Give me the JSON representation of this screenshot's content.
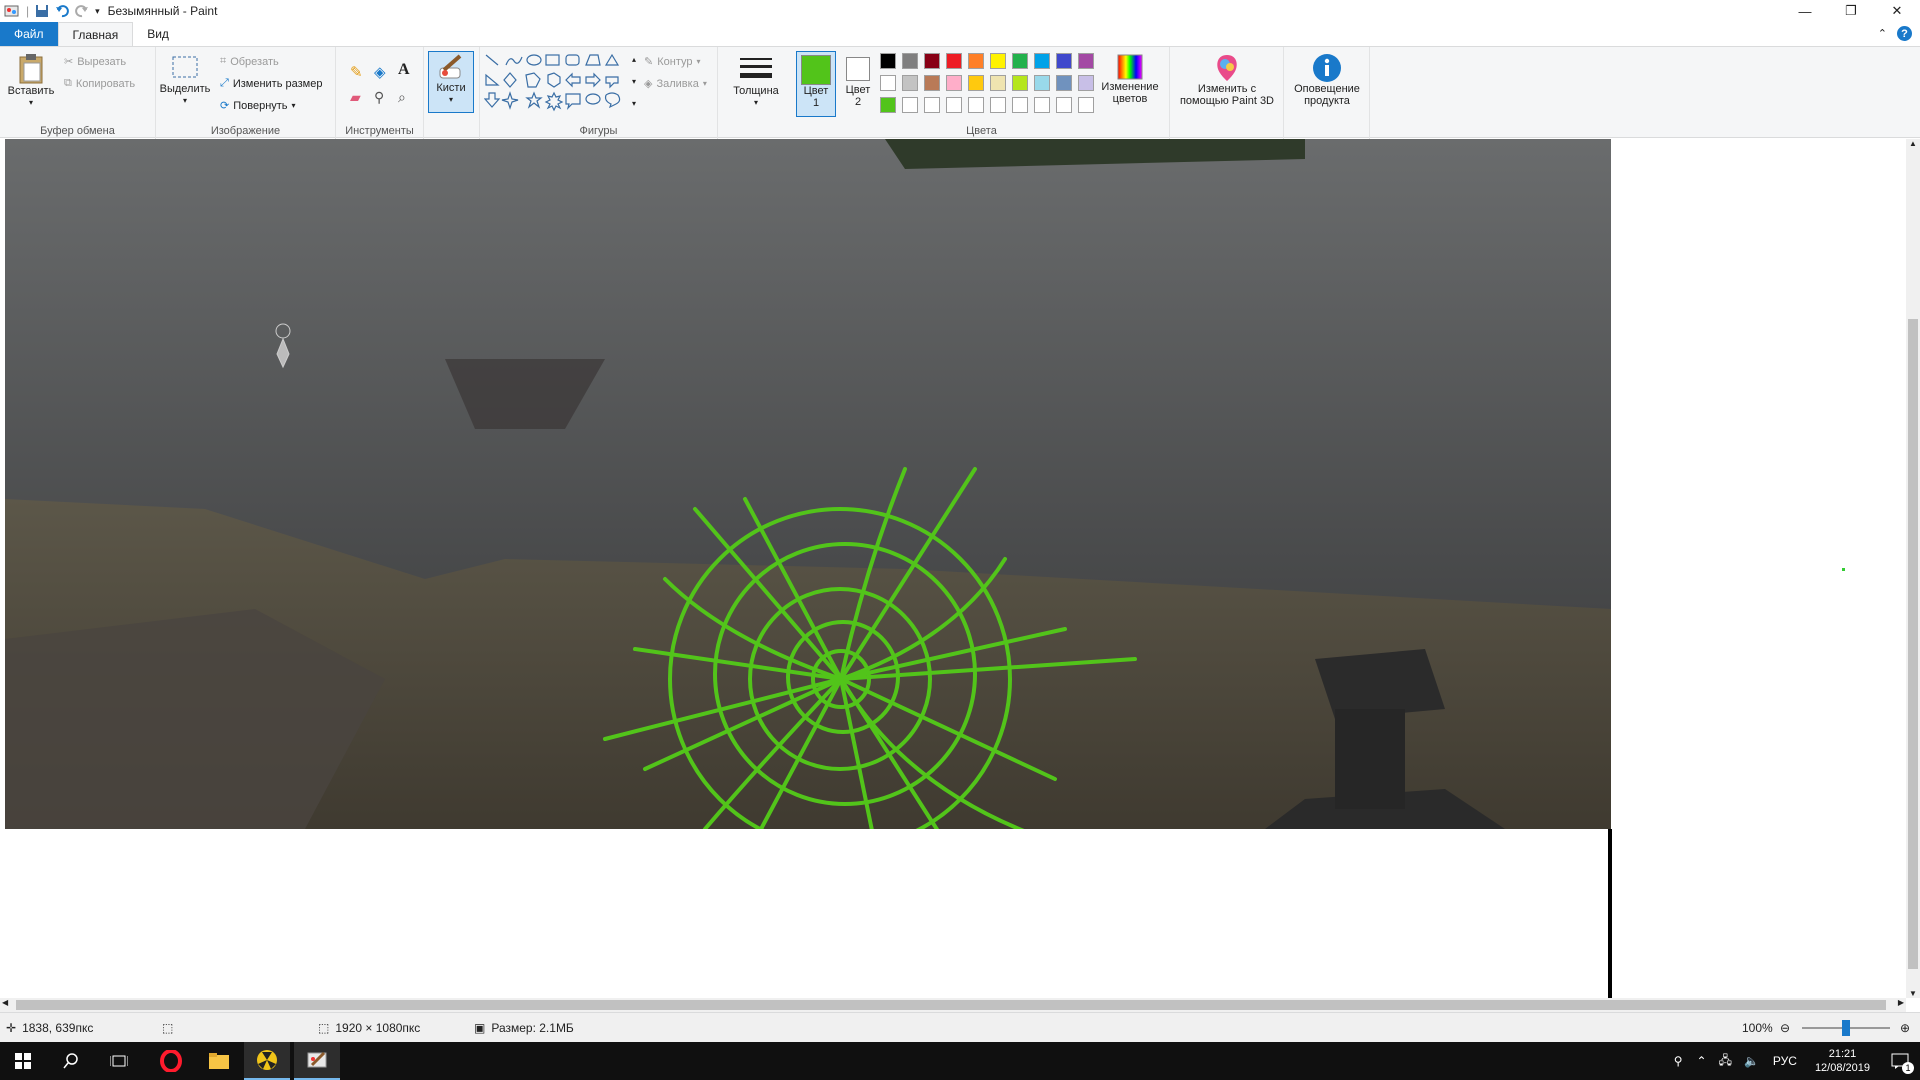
{
  "window": {
    "title": "Безымянный - Paint"
  },
  "tabs": {
    "file": "Файл",
    "home": "Главная",
    "view": "Вид"
  },
  "ribbon": {
    "clipboard": {
      "paste": "Вставить",
      "cut": "Вырезать",
      "copy": "Копировать",
      "label": "Буфер обмена"
    },
    "image": {
      "select": "Выделить",
      "crop": "Обрезать",
      "resize": "Изменить размер",
      "rotate": "Повернуть",
      "label": "Изображение"
    },
    "tools": {
      "label": "Инструменты"
    },
    "brushes": {
      "label": "Кисти"
    },
    "shapes": {
      "outline": "Контур",
      "fill": "Заливка",
      "label": "Фигуры"
    },
    "size": {
      "label": "Толщина"
    },
    "colors": {
      "color1_line1": "Цвет",
      "color1_line2": "1",
      "color2_line1": "Цвет",
      "color2_line2": "2",
      "edit_line1": "Изменение",
      "edit_line2": "цветов",
      "label": "Цвета",
      "color1_value": "#52c41a",
      "color2_value": "#ffffff",
      "palette": [
        "#000000",
        "#7f7f7f",
        "#880015",
        "#ed1c24",
        "#ff7f27",
        "#fff200",
        "#22b14c",
        "#00a2e8",
        "#3f48cc",
        "#a349a4",
        "#ffffff",
        "#c3c3c3",
        "#b97a57",
        "#ffaec9",
        "#ffc90e",
        "#efe4b0",
        "#b5e61d",
        "#99d9ea",
        "#7092be",
        "#c8bfe7",
        "#52c41a",
        "#ffffff",
        "#ffffff",
        "#ffffff",
        "#ffffff",
        "#ffffff",
        "#ffffff",
        "#ffffff",
        "#ffffff",
        "#ffffff"
      ]
    },
    "paint3d": {
      "line1": "Изменить с",
      "line2": "помощью Paint 3D"
    },
    "notice": {
      "line1": "Оповещение",
      "line2": "продукта"
    }
  },
  "status": {
    "cursor": "1838, 639пкс",
    "dimensions": "1920 × 1080пкс",
    "filesize": "Размер: 2.1МБ",
    "zoom": "100%"
  },
  "taskbar": {
    "lang": "РУС",
    "time": "21:21",
    "date": "12/08/2019",
    "notifications": "1"
  }
}
